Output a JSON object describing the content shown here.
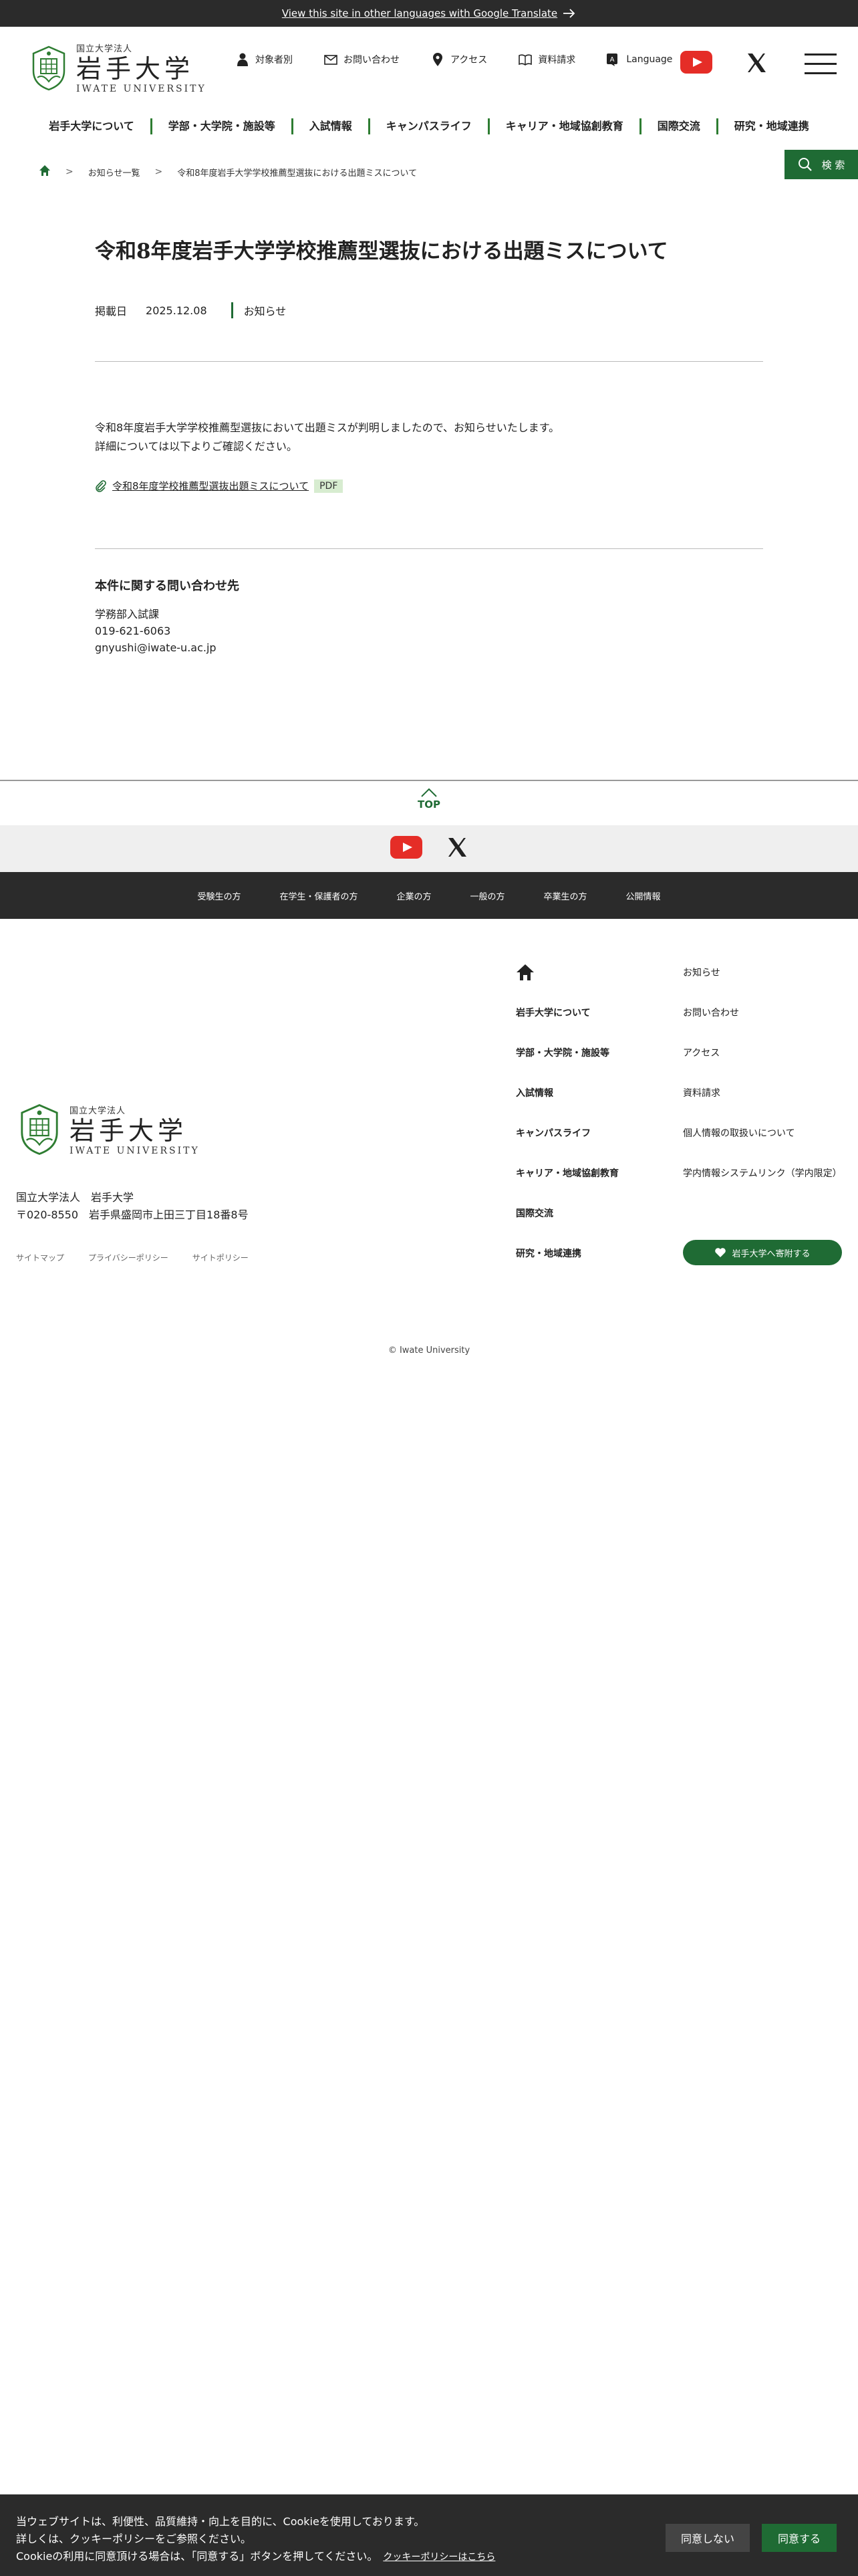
{
  "translate_bar": {
    "text": "View this site in other languages with Google Translate"
  },
  "logo": {
    "small": "国立大学法人",
    "big": "岩手大学",
    "en": "IWATE UNIVERSITY"
  },
  "header_nav": [
    {
      "label": "対象者別",
      "icon": "person-icon"
    },
    {
      "label": "お問い合わせ",
      "icon": "mail-icon"
    },
    {
      "label": "アクセス",
      "icon": "map-pin-icon"
    },
    {
      "label": "資料請求",
      "icon": "book-icon"
    },
    {
      "label": "Language",
      "icon": "translate-icon"
    }
  ],
  "global_nav": [
    "岩手大学について",
    "学部・大学院・施設等",
    "入試情報",
    "キャンパスライフ",
    "キャリア・地域協創教育",
    "国際交流",
    "研究・地域連携"
  ],
  "breadcrumb": {
    "list": "お知らせ一覧",
    "current": "令和8年度岩手大学学校推薦型選抜における出題ミスについて"
  },
  "search_label": "検 索",
  "article": {
    "title": "令和8年度岩手大学学校推薦型選抜における出題ミスについて",
    "date_label": "掲載日",
    "date": "2025.12.08",
    "category": "お知らせ",
    "body_line1": "令和8年度岩手大学学校推薦型選抜において出題ミスが判明しましたので、お知らせいたします。",
    "body_line2": "詳細については以下よりご確認ください。",
    "file_name": "令和8年度学校推薦型選抜出題ミスについて",
    "file_type": "PDF"
  },
  "contact": {
    "heading": "本件に関する問い合わせ先",
    "dept": "学務部入試課",
    "phone": "019-621-6063",
    "email": "gnyushi@iwate-u.ac.jp"
  },
  "to_top": "TOP",
  "target_nav": [
    "受験生の方",
    "在学生・保護者の方",
    "企業の方",
    "一般の方",
    "卒業生の方",
    "公開情報"
  ],
  "footer": {
    "address_line1": "国立大学法人　岩手大学",
    "address_line2": "〒020-8550　岩手県盛岡市上田三丁目18番8号",
    "links": [
      "サイトマップ",
      "プライバシーポリシー",
      "サイトポリシー"
    ],
    "col1": [
      "岩手大学について",
      "学部・大学院・施設等",
      "入試情報",
      "キャンパスライフ",
      "キャリア・地域協創教育",
      "国際交流",
      "研究・地域連携"
    ],
    "col2": [
      "お知らせ",
      "お問い合わせ",
      "アクセス",
      "資料請求",
      "個人情報の取扱いについて",
      "学内情報システムリンク（学内限定）"
    ],
    "donate": "岩手大学へ寄附する",
    "copyright": "© Iwate University"
  },
  "cookie": {
    "line1": "当ウェブサイトは、利便性、品質維持・向上を目的に、Cookieを使用しております。",
    "line2": "詳しくは、クッキーポリシーをご参照ください。",
    "line3": "Cookieの利用に同意頂ける場合は、「同意する」ボタンを押してください。",
    "policy_link": "クッキーポリシーはこちら",
    "decline": "同意しない",
    "accept": "同意する"
  },
  "colors": {
    "brand_green": "#1f6b34",
    "dark_bar": "#2b2b2b"
  }
}
